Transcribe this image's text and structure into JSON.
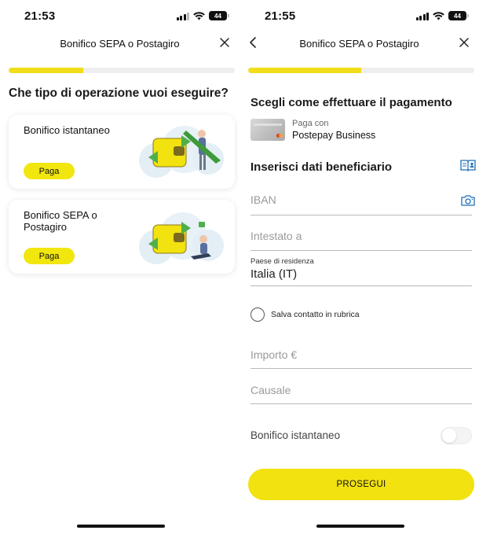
{
  "left": {
    "status": {
      "time": "21:53",
      "battery": "44"
    },
    "header": {
      "title": "Bonifico SEPA o Postagiro"
    },
    "progress": 0.33,
    "question": "Che tipo di operazione vuoi eseguire?",
    "cards": [
      {
        "label": "Bonifico istantaneo",
        "button": "Paga"
      },
      {
        "label": "Bonifico SEPA o Postagiro",
        "button": "Paga"
      }
    ]
  },
  "right": {
    "status": {
      "time": "21:55",
      "battery": "44"
    },
    "header": {
      "title": "Bonifico SEPA o Postagiro"
    },
    "progress": 0.5,
    "payment_section": "Scegli come effettuare il pagamento",
    "pay_with": {
      "label": "Paga con",
      "value": "Postepay Business"
    },
    "beneficiary_section": "Inserisci dati beneficiario",
    "fields": {
      "iban": {
        "placeholder": "IBAN"
      },
      "holder": {
        "placeholder": "Intestato a"
      },
      "country": {
        "label": "Paese di residenza",
        "value": "Italia (IT)"
      },
      "amount": {
        "placeholder": "Importo €"
      },
      "reason": {
        "placeholder": "Causale"
      }
    },
    "save_contact": "Salva contatto in rubrica",
    "instant_toggle": {
      "label": "Bonifico istantaneo",
      "on": false
    },
    "cta": "PROSEGUI"
  },
  "colors": {
    "accent": "#f2e20f",
    "divider": "#b9b9b9"
  }
}
